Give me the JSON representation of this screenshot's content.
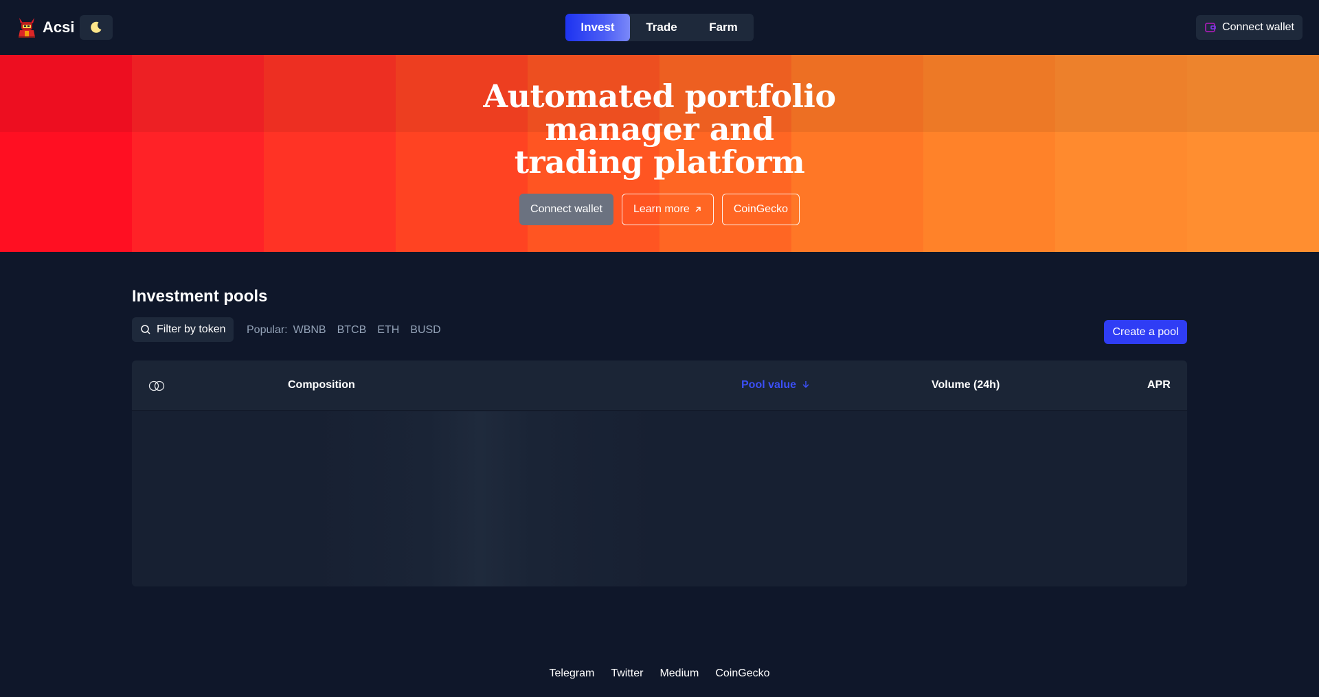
{
  "header": {
    "brand": "Acsi",
    "tabs": [
      {
        "label": "Invest",
        "active": true
      },
      {
        "label": "Trade",
        "active": false
      },
      {
        "label": "Farm",
        "active": false
      }
    ],
    "wallet_label": "Connect wallet"
  },
  "hero": {
    "title": "Automated portfolio manager and trading platform",
    "buttons": {
      "connect": "Connect wallet",
      "learn_more": "Learn more",
      "coingecko": "CoinGecko"
    },
    "gradient_colors": [
      "#ff0f22",
      "#ff2227",
      "#ff3325",
      "#ff4322",
      "#ff5522",
      "#ff6623",
      "#ff7726",
      "#ff8229",
      "#ff8a2e",
      "#ff8e30"
    ]
  },
  "pools": {
    "title": "Investment pools",
    "filter_label": "Filter by token",
    "popular_label": "Popular:",
    "popular_tokens": [
      "WBNB",
      "BTCB",
      "ETH",
      "BUSD"
    ],
    "create_label": "Create a pool",
    "columns": {
      "composition": "Composition",
      "pool_value": "Pool value",
      "volume": "Volume (24h)",
      "apr": "APR"
    },
    "sort_column": "pool_value",
    "sort_direction": "descending"
  },
  "footer": {
    "links": [
      "Telegram",
      "Twitter",
      "Medium",
      "CoinGecko"
    ]
  },
  "colors": {
    "background": "#0f172a",
    "surface": "#1e293b",
    "accent": "#2f3df5",
    "muted_text": "#94a3b8"
  }
}
